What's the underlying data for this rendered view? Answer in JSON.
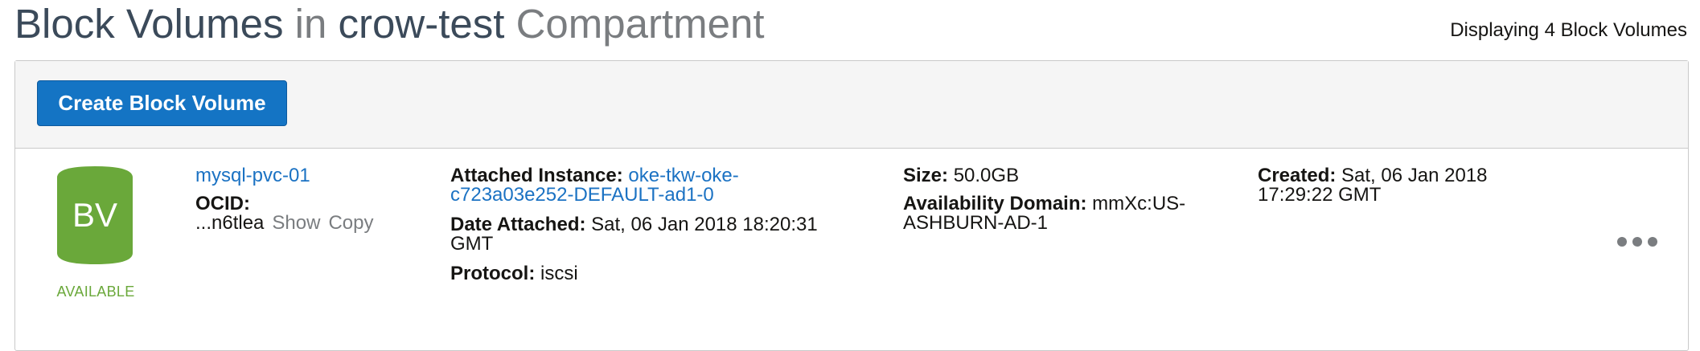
{
  "header": {
    "title_part1": "Block Volumes",
    "title_in": "in",
    "title_compartment_name": "crow-test",
    "title_compartment_word": "Compartment",
    "count_text": "Displaying 4 Block Volumes"
  },
  "toolbar": {
    "create_button_label": "Create Block Volume",
    "button_color": "#1474c4"
  },
  "volume": {
    "icon_initials": "BV",
    "icon_color": "#6aa83a",
    "status": "AVAILABLE",
    "name": "mysql-pvc-01",
    "ocid_label": "OCID:",
    "ocid_value": "...n6tlea",
    "show_label": "Show",
    "copy_label": "Copy",
    "attached_instance_label": "Attached Instance:",
    "attached_instance_line1": "oke-tkw-oke-",
    "attached_instance_line2": "c723a03e252-DEFAULT-ad1-0",
    "date_attached_label": "Date Attached:",
    "date_attached_line1": "Sat, 06 Jan 2018 18:20:31",
    "date_attached_line2": "GMT",
    "protocol_label": "Protocol:",
    "protocol_value": "iscsi",
    "size_label": "Size:",
    "size_value": "50.0GB",
    "availability_domain_label": "Availability Domain:",
    "availability_domain_line1": "mmXc:US-",
    "availability_domain_line2": "ASHBURN-AD-1",
    "created_label": "Created:",
    "created_line1": "Sat, 06 Jan 2018",
    "created_line2": "17:29:22 GMT",
    "actions_icon": "more-horizontal-icon"
  }
}
